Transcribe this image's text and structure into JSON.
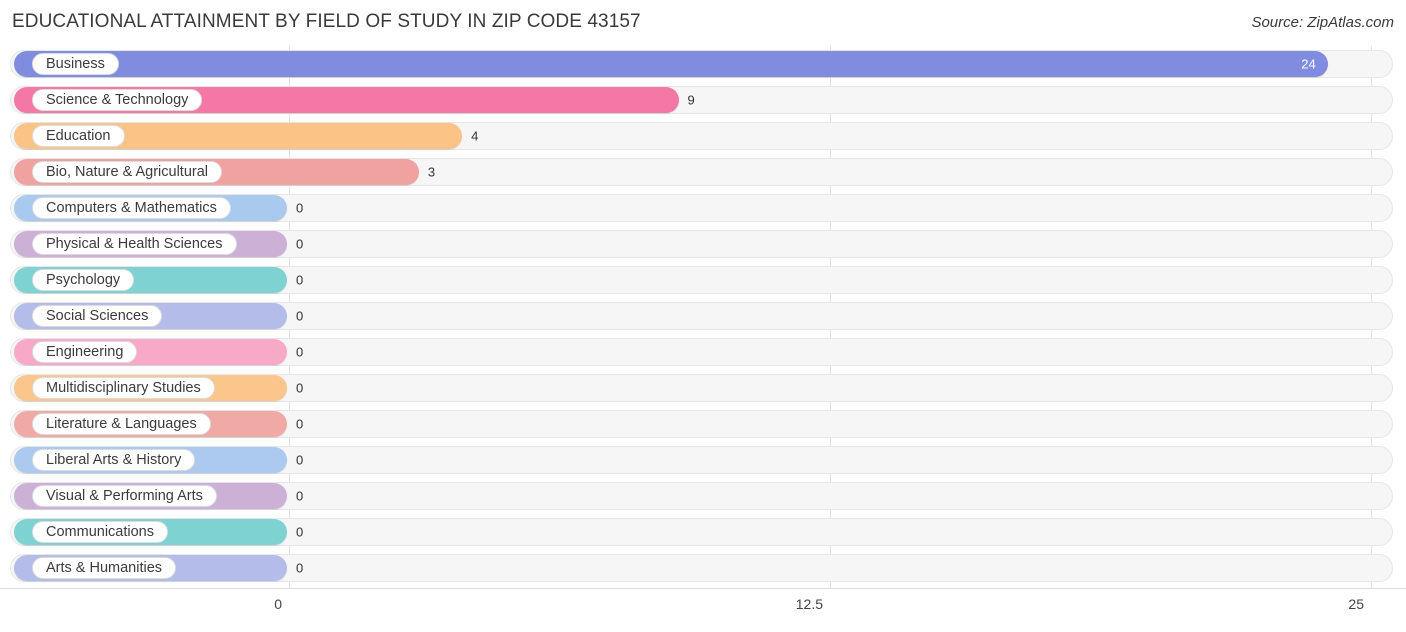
{
  "header": {
    "title": "EDUCATIONAL ATTAINMENT BY FIELD OF STUDY IN ZIP CODE 43157",
    "source": "Source: ZipAtlas.com"
  },
  "chart_data": {
    "type": "bar",
    "orientation": "horizontal",
    "title": "EDUCATIONAL ATTAINMENT BY FIELD OF STUDY IN ZIP CODE 43157",
    "subtitle": "Source: ZipAtlas.com",
    "xlabel": "",
    "ylabel": "",
    "xlim": [
      0,
      25
    ],
    "grid": true,
    "legend": false,
    "xticks": [
      "0",
      "12.5",
      "25"
    ],
    "xtick_values": [
      0,
      12.5,
      25
    ],
    "categories": [
      "Business",
      "Science & Technology",
      "Education",
      "Bio, Nature & Agricultural",
      "Computers & Mathematics",
      "Physical & Health Sciences",
      "Psychology",
      "Social Sciences",
      "Engineering",
      "Multidisciplinary Studies",
      "Literature & Languages",
      "Liberal Arts & History",
      "Visual & Performing Arts",
      "Communications",
      "Arts & Humanities"
    ],
    "values": [
      24,
      9,
      4,
      3,
      0,
      0,
      0,
      0,
      0,
      0,
      0,
      0,
      0,
      0,
      0
    ],
    "value_labels": [
      "24",
      "9",
      "4",
      "3",
      "0",
      "0",
      "0",
      "0",
      "0",
      "0",
      "0",
      "0",
      "0",
      "0",
      "0"
    ],
    "colors": [
      "#7f8ce0",
      "#f478a6",
      "#fbc486",
      "#efa29f",
      "#a9c9ef",
      "#cdb0d6",
      "#7ed3d2",
      "#b4bde9",
      "#f8a9c8",
      "#fbc68c",
      "#f0a9a5",
      "#acc9ef",
      "#cdb0d6",
      "#7ed3d2",
      "#b4bde9"
    ]
  }
}
